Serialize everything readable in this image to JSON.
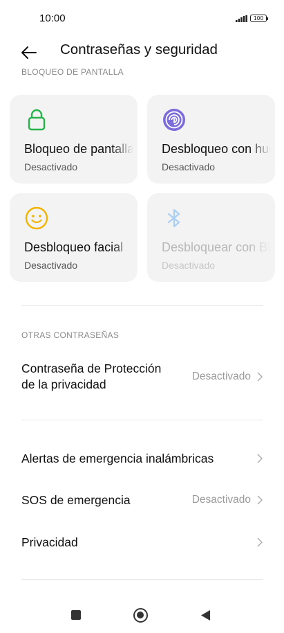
{
  "status_bar": {
    "time": "10:00",
    "battery": "100"
  },
  "header": {
    "title": "Contraseñas y seguridad"
  },
  "screen_lock_section": {
    "label": "BLOQUEO DE PANTALLA",
    "cards": [
      {
        "title": "Bloqueo de pantalla",
        "status": "Desactivado",
        "icon": "lock-icon",
        "color": "#27b24a"
      },
      {
        "title": "Desbloqueo con huella",
        "status": "Desactivado",
        "icon": "fingerprint-icon",
        "color": "#7c6cd9"
      },
      {
        "title": "Desbloqueo facial",
        "status": "Desactivado",
        "icon": "face-icon",
        "color": "#f0b400"
      },
      {
        "title": "Desbloquear con Bluetooth",
        "status": "Desactivado",
        "icon": "bluetooth-icon",
        "color": "#a9cff5"
      }
    ]
  },
  "other_passwords": {
    "label": "OTRAS CONTRASEÑAS",
    "privacy_password": {
      "title_line1": "Contraseña de Protección",
      "title_line2": "de la privacidad",
      "value": "Desactivado"
    }
  },
  "more_items": [
    {
      "title": "Alertas de emergencia inalámbricas",
      "value": ""
    },
    {
      "title": "SOS de emergencia",
      "value": "Desactivado"
    },
    {
      "title": "Privacidad",
      "value": ""
    }
  ]
}
